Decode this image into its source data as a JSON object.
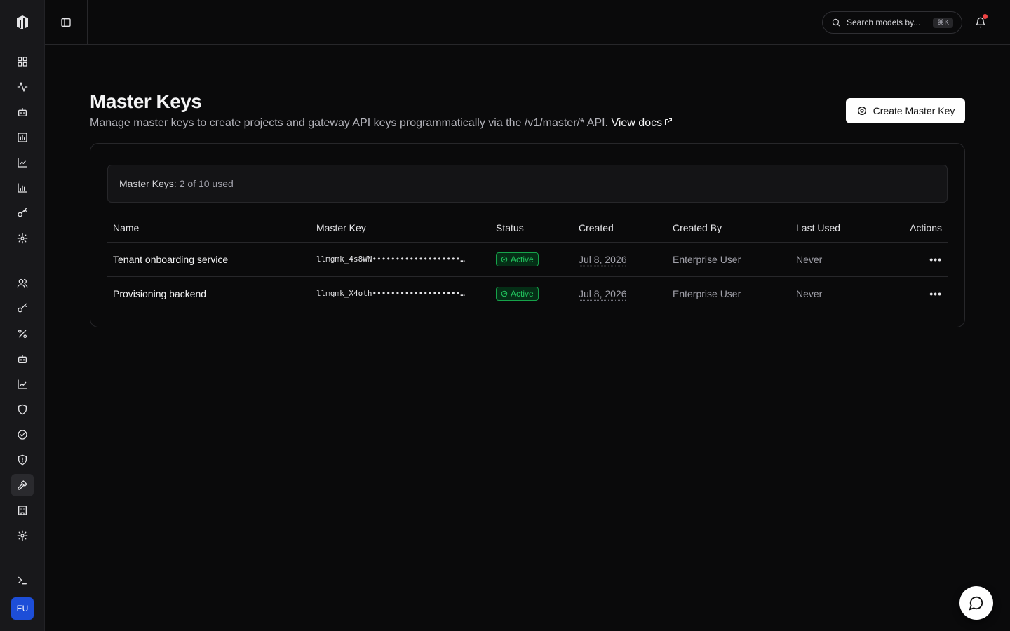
{
  "sidebar": {
    "avatar_initials": "EU",
    "items": [
      {
        "icon": "dashboard-icon"
      },
      {
        "icon": "activity-icon"
      },
      {
        "icon": "bot-icon"
      },
      {
        "icon": "bar-chart-icon"
      },
      {
        "icon": "trending-icon"
      },
      {
        "icon": "bar-chart-icon"
      },
      {
        "icon": "key-icon"
      },
      {
        "icon": "gear-icon"
      },
      {
        "icon": "users-icon"
      },
      {
        "icon": "key-icon"
      },
      {
        "icon": "percent-icon"
      },
      {
        "icon": "bot-icon"
      },
      {
        "icon": "trending-icon"
      },
      {
        "icon": "shield-icon"
      },
      {
        "icon": "check-circle-icon"
      },
      {
        "icon": "shield-alert-icon"
      },
      {
        "icon": "hammer-key-icon",
        "active": true
      },
      {
        "icon": "building-icon"
      },
      {
        "icon": "gear-icon"
      },
      {
        "icon": "terminal-icon"
      }
    ]
  },
  "header": {
    "search_placeholder": "Search models by...",
    "search_shortcut": "⌘K"
  },
  "page": {
    "title": "Master Keys",
    "subtitle": "Manage master keys to create projects and gateway API keys programmatically via the /v1/master/* API.",
    "docs_link": "View docs",
    "create_button": "Create Master Key"
  },
  "usage": {
    "label": "Master Keys:",
    "value": "2 of 10 used"
  },
  "table": {
    "headers": {
      "name": "Name",
      "key": "Master Key",
      "status": "Status",
      "created": "Created",
      "created_by": "Created By",
      "last_used": "Last Used",
      "actions": "Actions"
    },
    "rows": [
      {
        "name": "Tenant onboarding service",
        "key": "llmgmk_4s8WN•••••••••••••••••••…",
        "status": "Active",
        "created": "Jul 8, 2026",
        "created_by": "Enterprise User",
        "last_used": "Never",
        "actions": "•••"
      },
      {
        "name": "Provisioning backend",
        "key": "llmgmk_X4oth•••••••••••••••••••…",
        "status": "Active",
        "created": "Jul 8, 2026",
        "created_by": "Enterprise User",
        "last_used": "Never",
        "actions": "•••"
      }
    ]
  },
  "colors": {
    "accent_active": "#22c55e",
    "avatar": "#1d4ed8",
    "notification_dot": "#ef4444"
  }
}
